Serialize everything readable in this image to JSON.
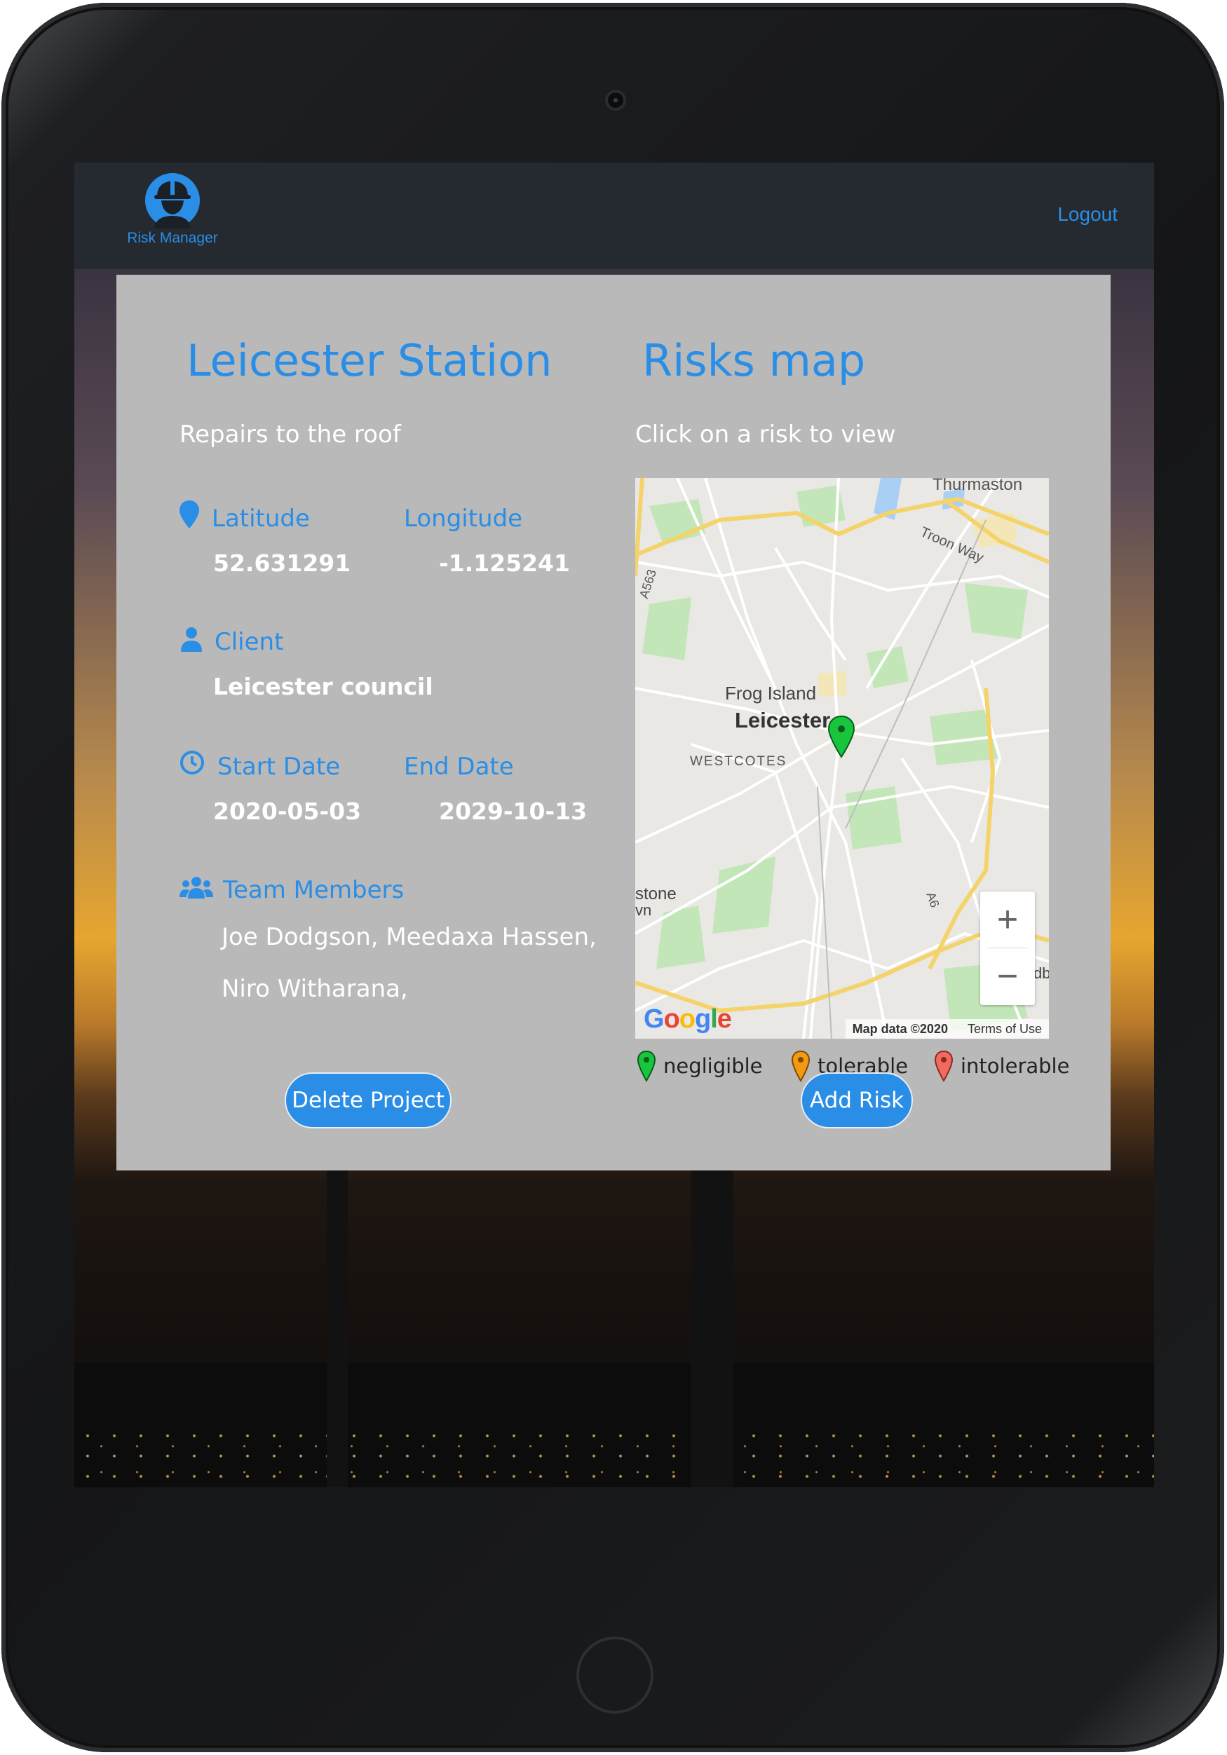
{
  "app": {
    "name": "Risk Manager",
    "logout_label": "Logout"
  },
  "project": {
    "title": "Leicester Station",
    "description": "Repairs to the roof",
    "latitude_label": "Latitude",
    "longitude_label": "Longitude",
    "latitude": "52.631291",
    "longitude": "-1.125241",
    "client_label": "Client",
    "client": "Leicester council",
    "start_label": "Start Date",
    "end_label": "End Date",
    "start_date": "2020-05-03",
    "end_date": "2029-10-13",
    "team_label": "Team Members",
    "team_line1": "Joe Dodgson,  Meedaxa Hassen,",
    "team_line2": "Niro Witharana,",
    "delete_label": "Delete Project"
  },
  "risks": {
    "title": "Risks map",
    "subtitle": "Click on a risk to view",
    "add_label": "Add Risk",
    "legend": [
      {
        "label": "negligible",
        "color": "#18c53c"
      },
      {
        "label": "tolerable",
        "color": "#f39a12"
      },
      {
        "label": "intolerable",
        "color": "#f06a5e"
      }
    ]
  },
  "map": {
    "places": {
      "thurmaston": "Thurmaston",
      "troon": "Troon Way",
      "a563": "A563",
      "frog": "Frog Island",
      "leicester": "Leicester",
      "westcotes": "WESTCOTES",
      "stone": "stone",
      "vn": "vn",
      "a6": "A6",
      "db": "db"
    },
    "zoom_in": "+",
    "zoom_out": "−",
    "attribution": "Map data ©2020",
    "terms": "Terms of Use",
    "provider": "Google",
    "marker_color": "#18c53c"
  }
}
